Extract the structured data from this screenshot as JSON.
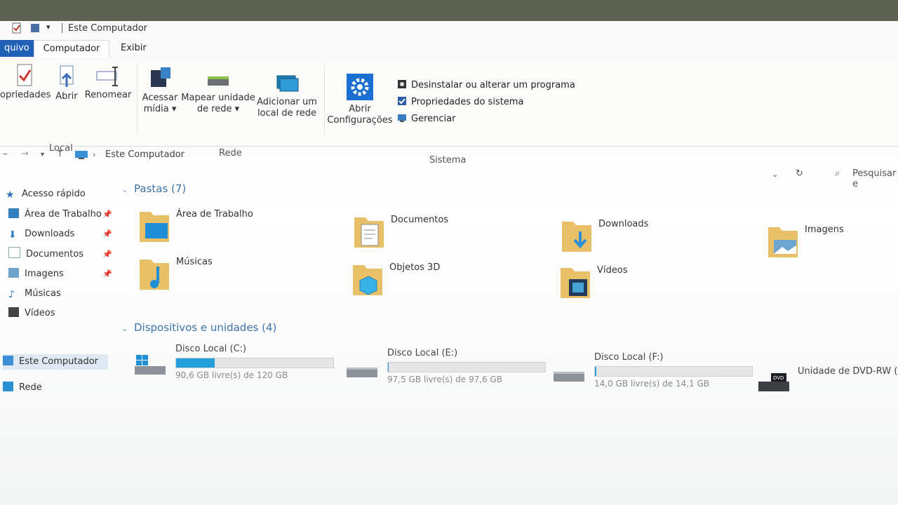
{
  "window": {
    "title": "Este Computador"
  },
  "tabs": {
    "file": "quivo",
    "computer": "Computador",
    "view": "Exibir"
  },
  "ribbon": {
    "local": {
      "label": "Local",
      "properties": "opriedades",
      "open": "Abrir",
      "rename": "Renomear"
    },
    "network": {
      "label": "Rede",
      "access_media": [
        "Acessar",
        "mídia ▾"
      ],
      "map_drive": [
        "Mapear unidade",
        "de rede ▾"
      ],
      "add_location": [
        "Adicionar um",
        "local de rede"
      ]
    },
    "system": {
      "label": "Sistema",
      "open_settings": [
        "Abrir",
        "Configurações"
      ],
      "uninstall": "Desinstalar ou alterar um programa",
      "system_properties": "Propriedades do sistema",
      "manage": "Gerenciar"
    }
  },
  "address": {
    "breadcrumb": "Este Computador",
    "search_placeholder": "Pesquisar e"
  },
  "sidebar": {
    "quick_access": "Acesso rápido",
    "items": [
      "Área de Trabalho",
      "Downloads",
      "Documentos",
      "Imagens",
      "Músicas",
      "Vídeos"
    ],
    "this_pc": "Este Computador",
    "network": "Rede"
  },
  "folders_section": {
    "title": "Pastas (7)",
    "items": [
      "Área de Trabalho",
      "Documentos",
      "Downloads",
      "Imagens",
      "Músicas",
      "Objetos 3D",
      "Vídeos"
    ]
  },
  "devices_section": {
    "title": "Dispositivos e unidades (4)",
    "drives": [
      {
        "name": "Disco Local (C:)",
        "free": "90,6 GB livre(s) de 120 GB",
        "used_fraction": 0.245
      },
      {
        "name": "Disco Local (E:)",
        "free": "97,5 GB livre(s) de 97,6 GB",
        "used_fraction": 0.001
      },
      {
        "name": "Disco Local (F:)",
        "free": "14,0 GB livre(s) de 14,1 GB",
        "used_fraction": 0.007
      },
      {
        "name": "Unidade de DVD-RW (G:)"
      }
    ]
  },
  "colors": {
    "accent": "#1f5fb6",
    "section_text": "#3c73a8",
    "bar_fill": "#26a0da"
  }
}
